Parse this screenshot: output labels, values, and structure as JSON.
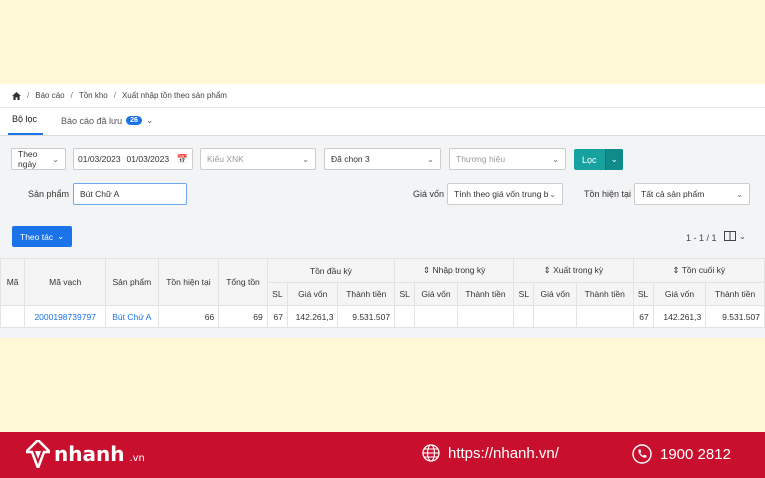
{
  "breadcrumb": {
    "home_icon": "home-icon",
    "items": [
      "Báo cáo",
      "Tồn kho",
      "Xuất nhập tồn theo sản phẩm"
    ]
  },
  "tabs": {
    "filter": "Bộ lọc",
    "saved": "Báo cáo đã lưu",
    "saved_count": "26"
  },
  "filters": {
    "period": "Theo ngày",
    "date_from": "01/03/2023",
    "date_to": "01/03/2023",
    "xnk_placeholder": "Kiểu XNK",
    "selected": "Đã chọn 3",
    "brand_placeholder": "Thương hiệu",
    "loc_label": "Lọc",
    "product_label": "Sản phẩm",
    "product_value": "Bút Chữ A",
    "cost_label": "Giá vốn",
    "cost_value": "Tính theo giá vốn trung bìr",
    "stock_label": "Tồn hiện tại",
    "stock_value": "Tất cả sản phẩm"
  },
  "actions": {
    "theo_tac": "Theo tác",
    "pager": "1 - 1 / 1"
  },
  "table": {
    "headers": {
      "ma": "Mã",
      "ma_vach": "Mã vạch",
      "san_pham": "Sản phẩm",
      "ton_hien_tai": "Tồn hiện tại",
      "tong_ton": "Tổng tồn",
      "ton_dau_ky": "Tồn đầu kỳ",
      "nhap_trong_ky": "Nhập trong kỳ",
      "xuat_trong_ky": "Xuất trong kỳ",
      "ton_cuoi_ky": "Tồn cuối kỳ",
      "sl": "SL",
      "gia_von": "Giá vốn",
      "thanh_tien": "Thành tiền"
    },
    "row": {
      "ma": "",
      "ma_vach": "2000198739797",
      "san_pham": "Bút Chứ A",
      "ton_hien_tai": "66",
      "tong_ton": "69",
      "dau_sl": "67",
      "dau_gia": "142.261,3",
      "dau_tien": "9.531.507",
      "nhap_sl": "",
      "nhap_gia": "",
      "nhap_tien": "",
      "xuat_sl": "",
      "xuat_gia": "",
      "xuat_tien": "",
      "cuoi_sl": "67",
      "cuoi_gia": "142.261,3",
      "cuoi_tien": "9.531.507"
    }
  },
  "footer": {
    "logo_text": "nhanh",
    "logo_suffix": ".vn",
    "url": "https://nhanh.vn/",
    "phone": "1900 2812"
  },
  "colors": {
    "accent": "#1a73e8",
    "filter_button": "#17a2a0",
    "footer_bg": "#c8102e",
    "page_bg": "#fff8d6"
  }
}
